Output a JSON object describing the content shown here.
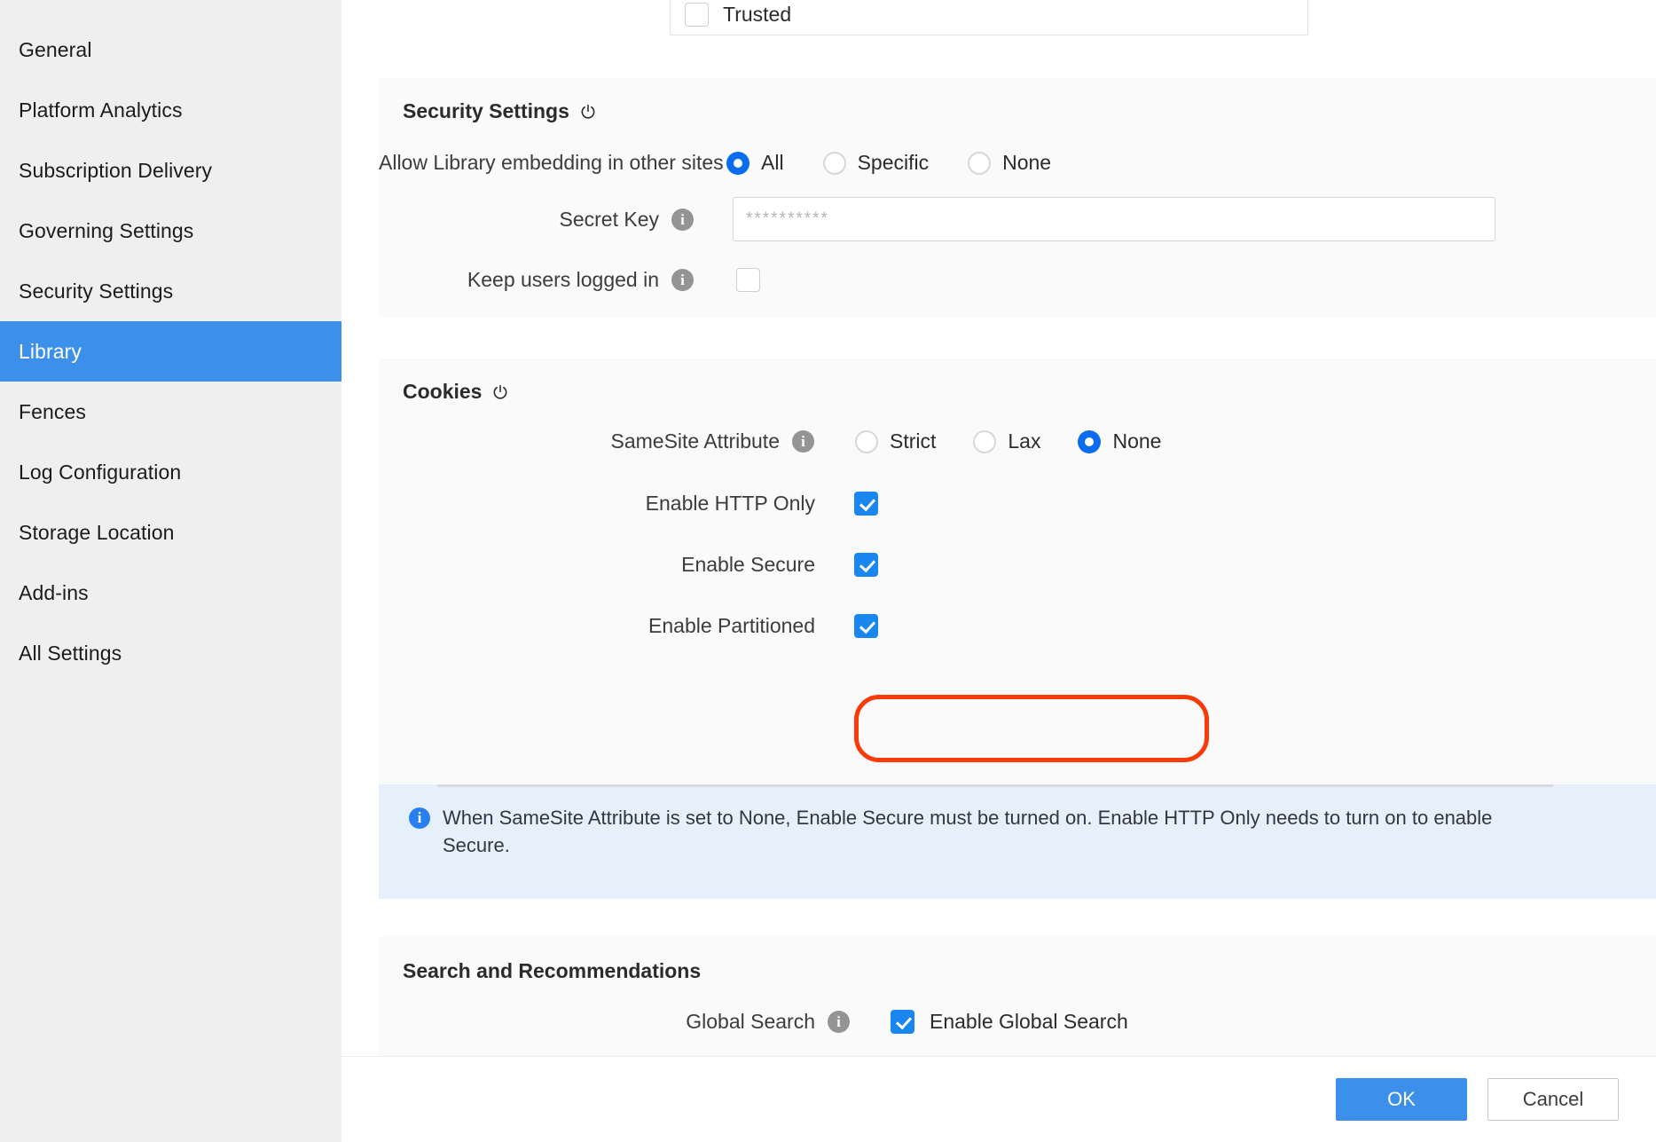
{
  "sidebar": {
    "items": [
      {
        "label": "General",
        "active": false
      },
      {
        "label": "Platform Analytics",
        "active": false
      },
      {
        "label": "Subscription Delivery",
        "active": false
      },
      {
        "label": "Governing Settings",
        "active": false
      },
      {
        "label": "Security Settings",
        "active": false
      },
      {
        "label": "Library",
        "active": true
      },
      {
        "label": "Fences",
        "active": false
      },
      {
        "label": "Log Configuration",
        "active": false
      },
      {
        "label": "Storage Location",
        "active": false
      },
      {
        "label": "Add-ins",
        "active": false
      },
      {
        "label": "All Settings",
        "active": false
      }
    ]
  },
  "top_panel": {
    "trusted_label": "Trusted",
    "trusted_checked": false
  },
  "security_settings": {
    "title": "Security Settings",
    "reset_icon": "power-reset-icon",
    "embedding": {
      "label": "Allow Library embedding in other sites",
      "options": [
        "All",
        "Specific",
        "None"
      ],
      "selected": "All"
    },
    "secret_key": {
      "label": "Secret Key",
      "info_icon": "info-icon",
      "value": "",
      "placeholder": "**********"
    },
    "keep_logged_in": {
      "label": "Keep users logged in",
      "info_icon": "info-icon",
      "checked": false
    }
  },
  "cookies": {
    "title": "Cookies",
    "reset_icon": "power-reset-icon",
    "samesite": {
      "label": "SameSite Attribute",
      "info_icon": "info-icon",
      "options": [
        "Strict",
        "Lax",
        "None"
      ],
      "selected": "None"
    },
    "http_only": {
      "label": "Enable HTTP Only",
      "checked": true
    },
    "secure": {
      "label": "Enable Secure",
      "checked": true
    },
    "partitioned": {
      "label": "Enable Partitioned",
      "checked": true,
      "highlighted": true
    }
  },
  "info_banner": {
    "icon": "info-icon",
    "text": "When SameSite Attribute is set to None, Enable Secure must be turned on. Enable HTTP Only needs to turn on to enable Secure."
  },
  "search_recommendations": {
    "title": "Search and Recommendations",
    "global_search": {
      "label": "Global Search",
      "info_icon": "info-icon",
      "checkbox_label": "Enable Global Search",
      "checked": true
    }
  },
  "footer": {
    "ok_label": "OK",
    "cancel_label": "Cancel"
  },
  "colors": {
    "accent": "#3d90ea",
    "radio_on": "#0b6cf0",
    "checkbox_on": "#1a87f0",
    "highlight": "#f93a09",
    "banner_bg": "#e6f0fb",
    "panel_bg": "#fafafa",
    "sidebar_bg": "#efefef"
  }
}
